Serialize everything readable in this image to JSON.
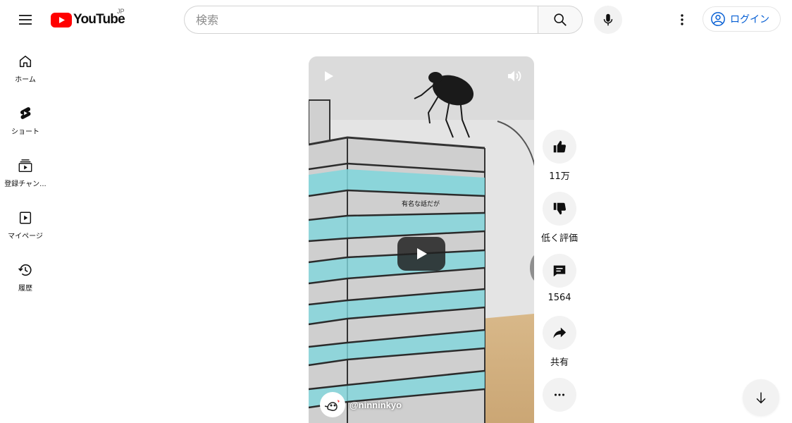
{
  "header": {
    "logo_text": "YouTube",
    "region": "JP",
    "search_placeholder": "検索",
    "login_label": "ログイン",
    "brand_color": "#ff0000",
    "link_color": "#065fd4"
  },
  "sidebar": {
    "items": [
      {
        "label": "ホーム",
        "icon": "home-icon"
      },
      {
        "label": "ショート",
        "icon": "shorts-icon"
      },
      {
        "label": "登録チャン...",
        "icon": "subscriptions-icon"
      },
      {
        "label": "マイページ",
        "icon": "library-icon"
      },
      {
        "label": "履歴",
        "icon": "history-icon"
      }
    ]
  },
  "video": {
    "caption": "有名な話だが",
    "channel": "@ninninkyo"
  },
  "actions": {
    "like_count": "11万",
    "dislike_label": "低く評価",
    "comment_count": "1564",
    "share_label": "共有"
  }
}
